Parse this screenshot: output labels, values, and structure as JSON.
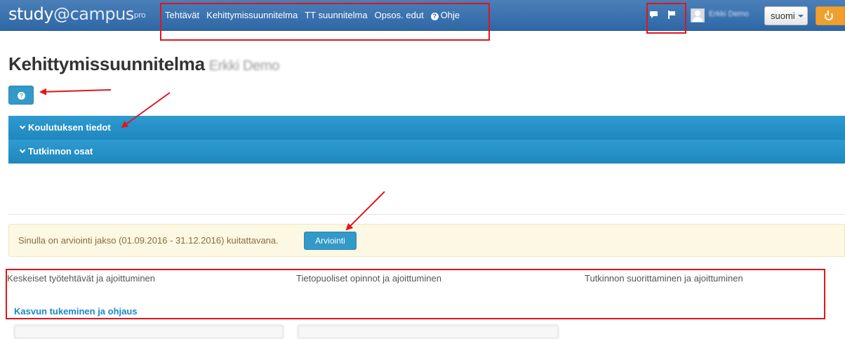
{
  "app": {
    "brand_main": "study",
    "brand_at": "@campus",
    "brand_sup": "pro"
  },
  "nav": {
    "links": [
      "Tehtävät",
      "Kehittymissuunnitelma",
      "TT suunnitelma",
      "Opsos. edut",
      "Ohje"
    ],
    "help_icon": "question-circle-icon",
    "icons": [
      "comment-icon",
      "flag-icon"
    ],
    "user_name": "Erkki Demo",
    "language": "suomi",
    "logout_icon": "power-icon"
  },
  "page": {
    "title": "Kehittymissuunnitelma",
    "user_name": "Erkki Demo",
    "help_button_icon": "question-circle-icon"
  },
  "accordion": [
    {
      "label": "Koulutuksen tiedot",
      "icon": "chevron-down-icon"
    },
    {
      "label": "Tutkinnon osat",
      "icon": "chevron-down-icon"
    }
  ],
  "alert": {
    "text": "Sinulla on arviointi jakso (01.09.2016 - 31.12.2016) kuitattavana.",
    "button": "Arviointi"
  },
  "columns": [
    "Keskeiset työtehtävät ja ajoittuminen",
    "Tietopuoliset opinnot ja ajoittuminen",
    "Tutkinnon suorittaminen ja ajoittuminen"
  ],
  "section_link": "Kasvun tukeminen ja ohjaus",
  "colors": {
    "navbar": "#2f67a6",
    "accent": "#3299c8",
    "alert_bg": "#fcf8e3",
    "annotation": "#e0151f",
    "power": "#f0a030"
  }
}
